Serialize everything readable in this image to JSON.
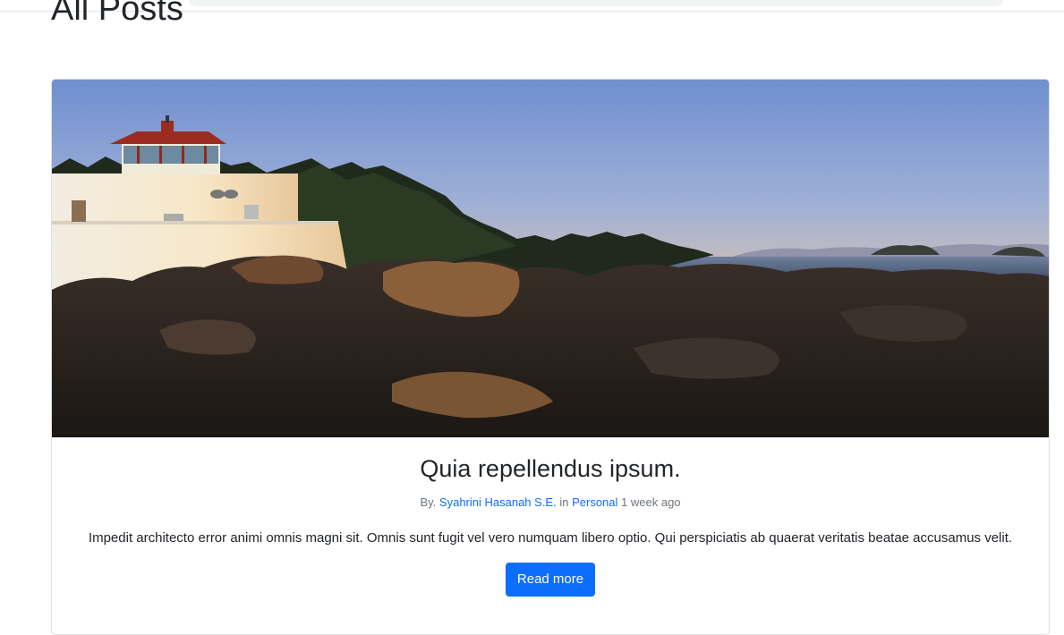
{
  "page": {
    "title": "All Posts"
  },
  "post": {
    "title": "Quia repellendus ipsum.",
    "by_label": "By.",
    "author": "Syahrini Hasanah S.E.",
    "in_label": "in",
    "category": "Personal",
    "time_ago": "1 week ago",
    "excerpt": "Impedit architecto error animi omnis magni sit. Omnis sunt fugit vel vero numquam libero optio. Qui perspiciatis ab quaerat veritatis beatae accusamus velit.",
    "read_more_label": "Read more",
    "image_subject": "lighthouse-on-rocky-coast-at-sunset"
  },
  "colors": {
    "link": "#0d6efd",
    "button_bg": "#0d6efd",
    "muted_text": "#6c757d",
    "heading_text": "#212529"
  }
}
